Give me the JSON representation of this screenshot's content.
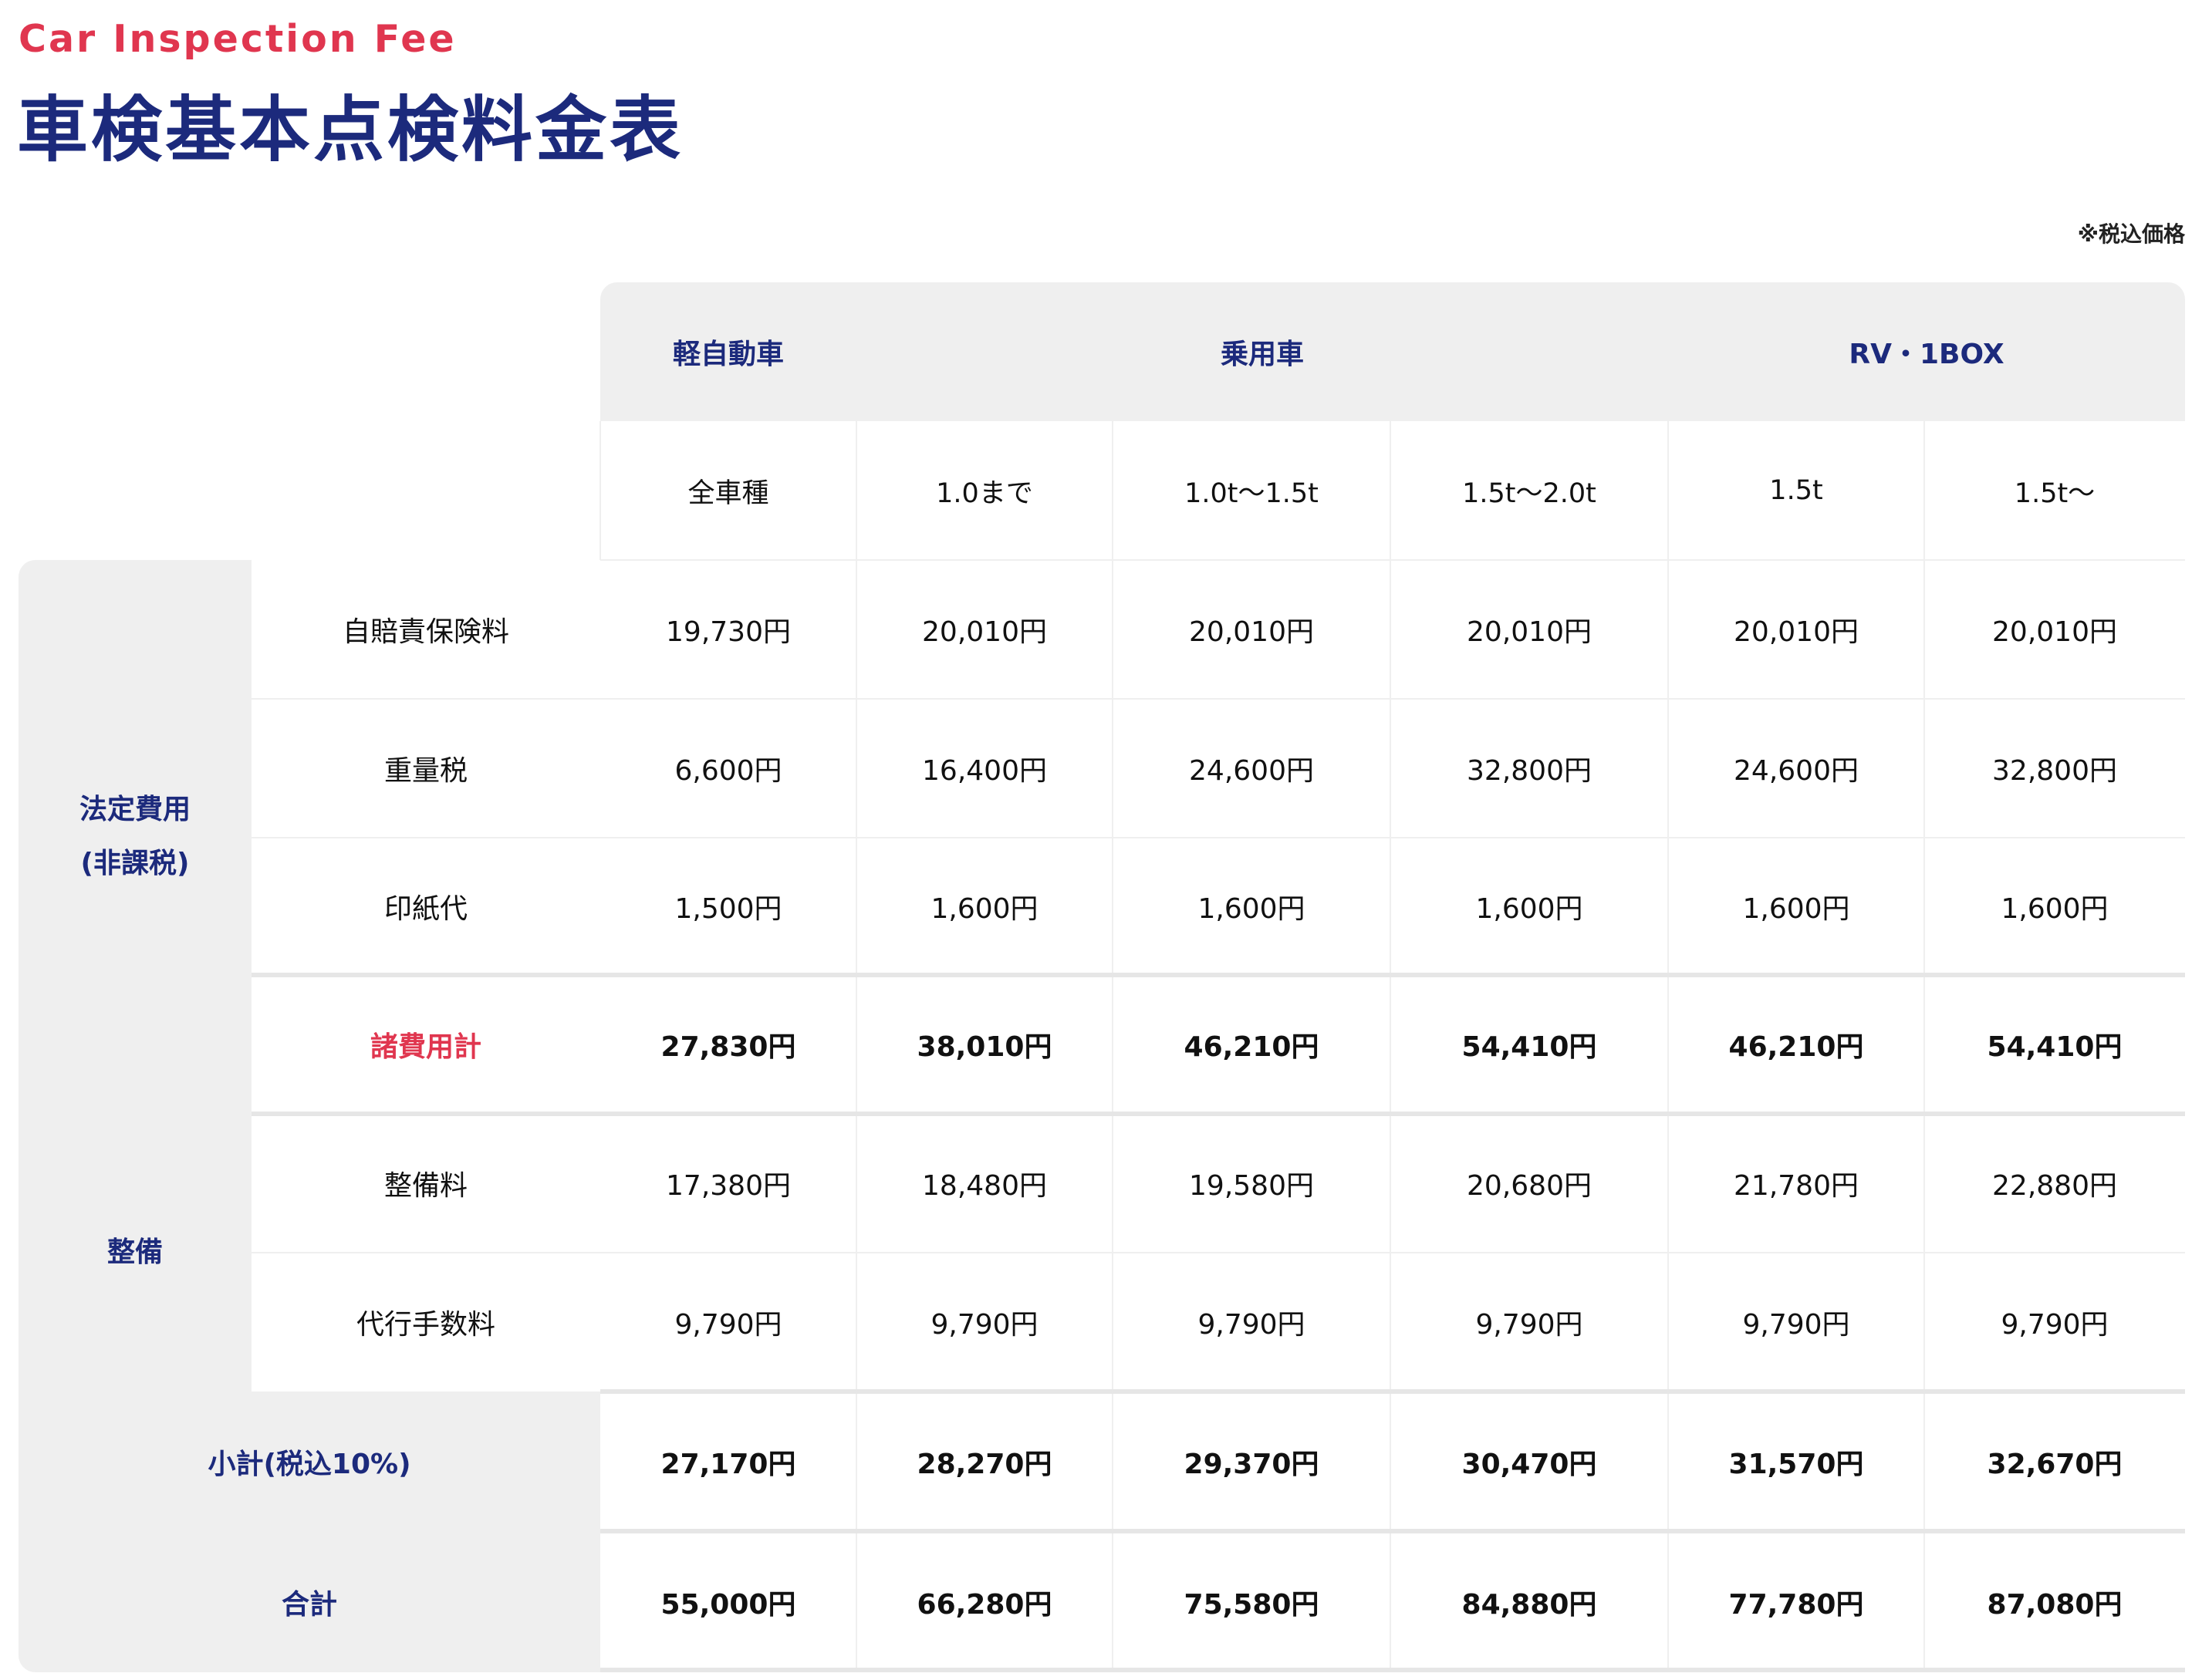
{
  "header": {
    "eyebrow": "Car Inspection Fee",
    "title": "車検基本点検料金表",
    "tax_note": "※税込価格"
  },
  "table": {
    "groups": [
      "軽自動車",
      "乗用車",
      "RV・1BOX"
    ],
    "columns": [
      "全車種",
      "1.0まで",
      "1.0t〜1.5t",
      "1.5t〜2.0t",
      "1.5t",
      "1.5t〜"
    ],
    "categories": {
      "legal_line1": "法定費用",
      "legal_line2": "(非課税)",
      "maintenance": "整備"
    },
    "rows": [
      {
        "label": "自賠責保険料",
        "values": [
          "19,730円",
          "20,010円",
          "20,010円",
          "20,010円",
          "20,010円",
          "20,010円"
        ]
      },
      {
        "label": "重量税",
        "values": [
          "6,600円",
          "16,400円",
          "24,600円",
          "32,800円",
          "24,600円",
          "32,800円"
        ]
      },
      {
        "label": "印紙代",
        "values": [
          "1,500円",
          "1,600円",
          "1,600円",
          "1,600円",
          "1,600円",
          "1,600円"
        ]
      },
      {
        "label": "諸費用計",
        "values": [
          "27,830円",
          "38,010円",
          "46,210円",
          "54,410円",
          "46,210円",
          "54,410円"
        ]
      },
      {
        "label": "整備料",
        "values": [
          "17,380円",
          "18,480円",
          "19,580円",
          "20,680円",
          "21,780円",
          "22,880円"
        ]
      },
      {
        "label": "代行手数料",
        "values": [
          "9,790円",
          "9,790円",
          "9,790円",
          "9,790円",
          "9,790円",
          "9,790円"
        ]
      },
      {
        "label": "小計(税込10%)",
        "values": [
          "27,170円",
          "28,270円",
          "29,370円",
          "30,470円",
          "31,570円",
          "32,670円"
        ]
      },
      {
        "label": "合計",
        "values": [
          "55,000円",
          "66,280円",
          "75,580円",
          "84,880円",
          "77,780円",
          "87,080円"
        ]
      }
    ]
  },
  "colors": {
    "accent_red": "#e0364f",
    "navy": "#1c2a7c",
    "header_gray": "#efefef"
  }
}
